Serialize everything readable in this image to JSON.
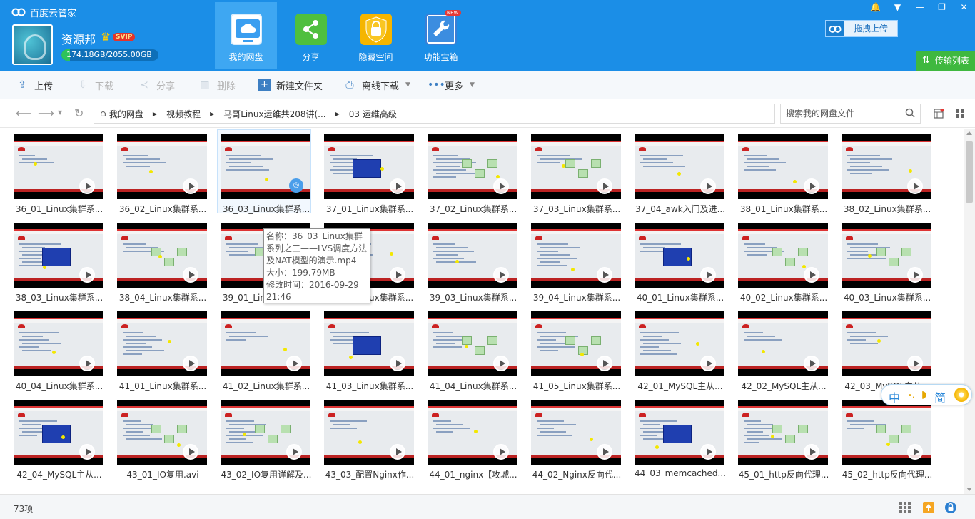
{
  "app": {
    "title": "百度云管家",
    "window_controls": [
      "🔔",
      "▼",
      "—",
      "❐",
      "✕"
    ]
  },
  "user": {
    "name": "资源邦",
    "badge": "SVIP",
    "storage_text": "174.18GB/2055.00GB",
    "storage_used_fraction": 0.085
  },
  "nav_tabs": [
    {
      "label": "我的网盘",
      "icon": "cloud-icon",
      "active": true
    },
    {
      "label": "分享",
      "icon": "share-icon",
      "active": false
    },
    {
      "label": "隐藏空间",
      "icon": "lock-icon",
      "active": false
    },
    {
      "label": "功能宝箱",
      "icon": "toolbox-icon",
      "active": false,
      "new_badge": "NEW"
    }
  ],
  "drag_upload_label": "拖拽上传",
  "transfer_list_label": "传输列表",
  "toolbar": {
    "upload": "上传",
    "download": "下载",
    "share": "分享",
    "delete": "删除",
    "new_folder": "新建文件夹",
    "offline_download": "离线下载",
    "more": "更多"
  },
  "breadcrumb": [
    "我的网盘",
    "视频教程",
    "马哥Linux运维共208讲(...",
    "03 运维高级"
  ],
  "search": {
    "placeholder": "搜索我的网盘文件"
  },
  "files": [
    "36_01_Linux集群系...",
    "36_02_Linux集群系...",
    "36_03_Linux集群系...",
    "37_01_Linux集群系...",
    "37_02_Linux集群系...",
    "37_03_Linux集群系...",
    "37_04_awk入门及进...",
    "38_01_Linux集群系...",
    "38_02_Linux集群系...",
    "38_03_Linux集群系...",
    "38_04_Linux集群系...",
    "39_01_Linux集群系...",
    "39_02_Linux集群系...",
    "39_03_Linux集群系...",
    "39_04_Linux集群系...",
    "40_01_Linux集群系...",
    "40_02_Linux集群系...",
    "40_03_Linux集群系...",
    "40_04_Linux集群系...",
    "41_01_Linux集群系...",
    "41_02_Linux集群系...",
    "41_03_Linux集群系...",
    "41_04_Linux集群系...",
    "41_05_Linux集群系...",
    "42_01_MySQL主从...",
    "42_02_MySQL主从...",
    "42_03_MySQL主从...",
    "42_04_MySQL主从...",
    "43_01_IO复用.avi",
    "43_02_IO复用详解及...",
    "43_03_配置Nginx作...",
    "44_01_nginx【攻城...",
    "44_02_Nginx反向代...",
    "44_03_memcached...",
    "45_01_http反向代理...",
    "45_02_http反向代理..."
  ],
  "tooltip": {
    "name_line": "名称：36_03_Linux集群系列之三——LVS调度方法及NAT模型的演示.mp4",
    "size_line": "大小：199.79MB",
    "modified_line": "修改时间：2016-09-29 21:46"
  },
  "ime": {
    "mode": "中",
    "charset": "简"
  },
  "status": {
    "item_count": "73项"
  },
  "colors": {
    "header": "#1b8ee7",
    "accent_green": "#3fb83f",
    "active_tab": "#3ea7f2"
  }
}
